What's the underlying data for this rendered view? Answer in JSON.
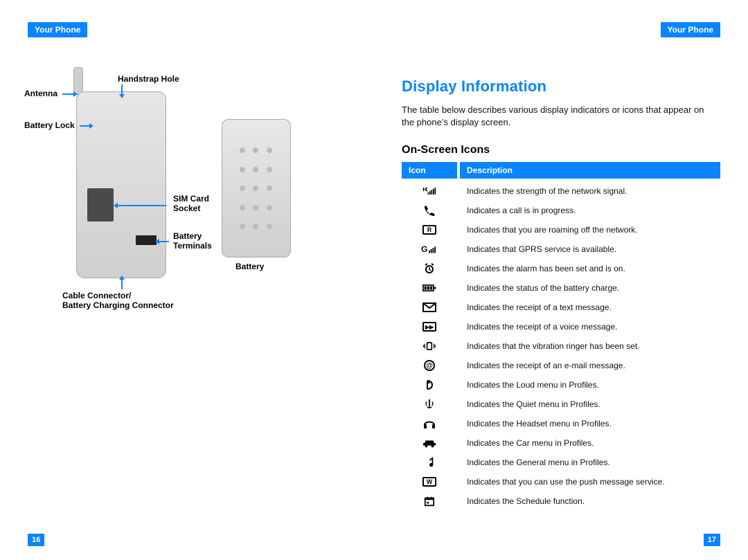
{
  "left": {
    "running_head": "Your Phone",
    "page_number": "16",
    "labels": {
      "antenna": "Antenna",
      "handstrap_hole": "Handstrap Hole",
      "battery_lock": "Battery Lock",
      "sim_card_socket_l1": "SIM Card",
      "sim_card_socket_l2": "Socket",
      "battery_terminals_l1": "Battery",
      "battery_terminals_l2": "Terminals",
      "battery": "Battery",
      "cable_connector_l1": "Cable Connector/",
      "cable_connector_l2": "Battery Charging Connector"
    }
  },
  "right": {
    "running_head": "Your Phone",
    "page_number": "17",
    "section_title": "Display Information",
    "intro": "The table below describes various display indicators or icons that appear on the phone’s display screen.",
    "subhead": "On-Screen Icons",
    "table_headers": {
      "icon": "Icon",
      "desc": "Description"
    },
    "rows": [
      {
        "id": "signal",
        "desc": "Indicates the strength of the network signal."
      },
      {
        "id": "call",
        "desc": "Indicates a call is in progress."
      },
      {
        "id": "roaming",
        "desc": "Indicates that you are roaming off the network."
      },
      {
        "id": "gprs",
        "desc": "Indicates that GPRS service is available."
      },
      {
        "id": "alarm",
        "desc": "Indicates the alarm has been set and is on."
      },
      {
        "id": "battery",
        "desc": "Indicates the status of the battery charge."
      },
      {
        "id": "sms",
        "desc": "Indicates the receipt of a text message."
      },
      {
        "id": "vmail",
        "desc": "Indicates the receipt of a voice message."
      },
      {
        "id": "vibrate",
        "desc": "Indicates that the vibration ringer has been set."
      },
      {
        "id": "email",
        "desc": "Indicates the receipt of an e-mail message."
      },
      {
        "id": "loud",
        "desc": "Indicates the Loud menu in Profiles."
      },
      {
        "id": "quiet",
        "desc": "Indicates the Quiet menu in Profiles."
      },
      {
        "id": "headset",
        "desc": "Indicates the Headset menu in Profiles."
      },
      {
        "id": "car",
        "desc": "Indicates the Car menu in Profiles."
      },
      {
        "id": "general",
        "desc": "Indicates the General menu in Profiles."
      },
      {
        "id": "push",
        "desc": "Indicates that you can use the push message service."
      },
      {
        "id": "schedule",
        "desc": "Indicates the Schedule function."
      }
    ]
  }
}
